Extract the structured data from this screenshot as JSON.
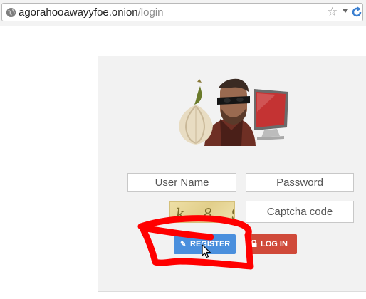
{
  "browser": {
    "url_host": "agorahooawayyfoe.onion",
    "url_path": "/login"
  },
  "login": {
    "username_placeholder": "User Name",
    "password_placeholder": "Password",
    "captcha_placeholder": "Captcha code",
    "captcha_text": "k 8 9",
    "register_label": "REGISTER",
    "login_label": "LOG IN"
  },
  "colors": {
    "register_button": "#4a8fdd",
    "login_button": "#d04a3a",
    "annotation": "#ff0000"
  }
}
